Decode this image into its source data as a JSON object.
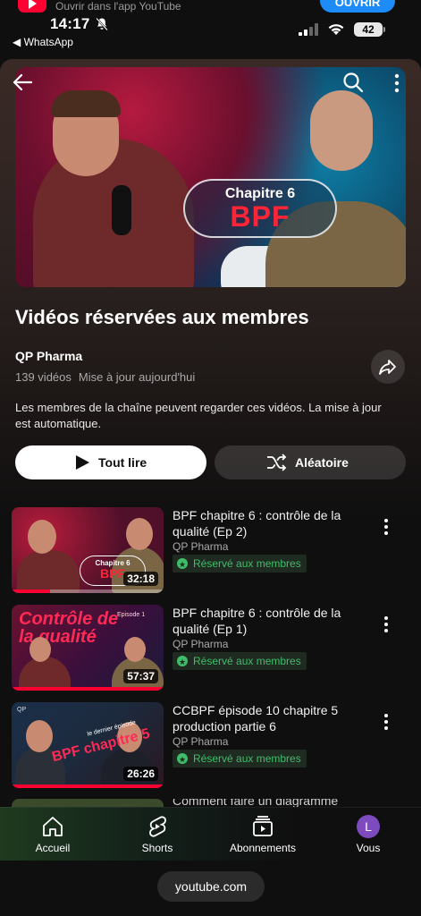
{
  "banner": {
    "text": "Ouvrir dans l'app YouTube",
    "open_label": "OUVRIR"
  },
  "status_bar": {
    "time": "14:17",
    "back_app": "◀ WhatsApp",
    "battery": "42"
  },
  "playlist": {
    "title": "Vidéos réservées aux membres",
    "channel": "QP Pharma",
    "video_count": "139 vidéos",
    "updated": "Mise à jour aujourd'hui",
    "description": "Les membres de la chaîne peuvent regarder ces vidéos. La mise à jour est automatique.",
    "hero": {
      "chapter": "Chapitre 6",
      "bpf": "BPF"
    },
    "play_all_label": "Tout lire",
    "shuffle_label": "Aléatoire"
  },
  "videos": [
    {
      "title": "BPF chapitre 6 : contrôle de la qualité (Ep 2)",
      "channel": "QP Pharma",
      "badge": "Réservé aux membres",
      "duration": "32:18",
      "thumb_text": "Chapitre 6",
      "thumb_text2": "BPF",
      "progress": 0.25
    },
    {
      "title": "BPF chapitre 6 : contrôle de la qualité (Ep 1)",
      "channel": "QP Pharma",
      "badge": "Réservé aux membres",
      "duration": "57:37",
      "thumb_text": "Contrôle de la qualité",
      "thumb_text2": "Episode 1",
      "progress": 1.0
    },
    {
      "title": "CCBPF épisode 10 chapitre 5 production partie 6",
      "channel": "QP Pharma",
      "badge": "Réservé aux membres",
      "duration": "26:26",
      "thumb_text": "BPF chapitre 5",
      "thumb_text2": "le dernier épisode",
      "progress": 1.0
    }
  ],
  "peek_title": "Comment faire un diagramme",
  "bottom_nav": [
    {
      "label": "Accueil",
      "icon": "home-icon"
    },
    {
      "label": "Shorts",
      "icon": "shorts-icon"
    },
    {
      "label": "Abonnements",
      "icon": "subscriptions-icon"
    },
    {
      "label": "Vous",
      "icon": "avatar",
      "avatar_letter": "L"
    }
  ],
  "browser": {
    "url": "youtube.com"
  },
  "colors": {
    "brand_red": "#ff0033",
    "member_green": "#3fbe6a",
    "accent_blue": "#1d8cf8"
  }
}
